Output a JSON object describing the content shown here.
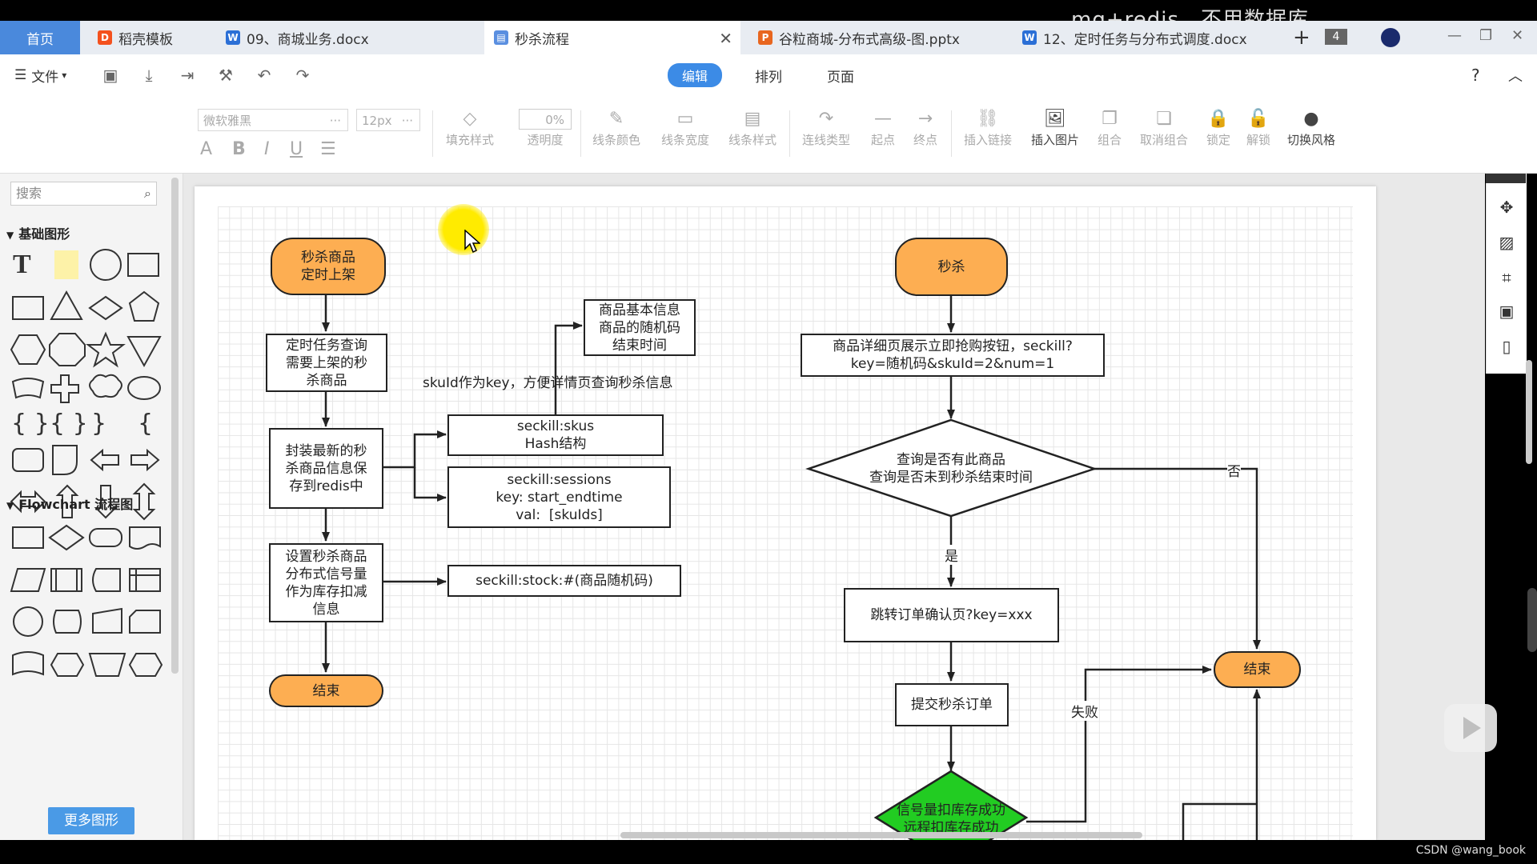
{
  "watermark": "mq+redis，不用数据库",
  "tabs": [
    {
      "label": "首页"
    },
    {
      "label": "稻壳模板"
    },
    {
      "label": "09、商城业务.docx"
    },
    {
      "label": "秒杀流程"
    },
    {
      "label": "谷粒商城-分布式高级-图.pptx"
    },
    {
      "label": "12、定时任务与分布式调度.docx"
    }
  ],
  "tab_count": "4",
  "menu": {
    "file": "文件",
    "modes": [
      "编辑",
      "排列",
      "页面"
    ],
    "help": "?"
  },
  "toolbar": {
    "font_family": "微软雅黑",
    "font_size": "12px",
    "opacity_value": "0%",
    "format_buttons": [
      "A",
      "B",
      "I",
      "U"
    ],
    "tools": [
      "填充样式",
      "透明度",
      "线条颜色",
      "线条宽度",
      "线条样式",
      "连线类型",
      "起点",
      "终点",
      "插入链接",
      "插入图片",
      "组合",
      "取消组合",
      "锁定",
      "解锁",
      "切换风格"
    ]
  },
  "sidebar": {
    "search_placeholder": "搜索",
    "section_basic": "基础图形",
    "section_flowchart": "Flowchart 流程图",
    "more_shapes": "更多图形"
  },
  "flow": {
    "left": {
      "start": "秒杀商品\n定时上架",
      "step1": "定时任务查询\n需要上架的秒\n杀商品",
      "step2": "封装最新的秒\n杀商品信息保\n存到redis中",
      "step3": "设置秒杀商品\n分布式信号量\n作为库存扣减\n信息",
      "end": "结束",
      "info_box": "商品基本信息\n商品的随机码\n结束时间",
      "key_note": "skuId作为key，方便详情页查询秒杀信息",
      "skus_box": "seckill:skus\nHash结构",
      "sessions_box": "seckill:sessions\nkey: start_endtime\nval:  [skuIds]",
      "stock_box": "seckill:stock:#(商品随机码)"
    },
    "right": {
      "start": "秒杀",
      "step1": "商品详细页展示立即抢购按钮，seckill?\nkey=随机码&skuId=2&num=1",
      "decision": "查询是否有此商品\n查询是否未到秒杀结束时间",
      "no_label": "否",
      "yes_label": "是",
      "step2": "跳转订单确认页?key=xxx",
      "step3": "提交秒杀订单",
      "decision2": "信号量扣库存成功\n远程扣库存成功",
      "fail_label": "失败",
      "end": "结束"
    }
  },
  "footer": {
    "credit": "CSDN @wang_book"
  },
  "colors": {
    "accent": "#4a89dc",
    "terminal_fill": "#fdae52",
    "decision_green": "#22cc22"
  }
}
